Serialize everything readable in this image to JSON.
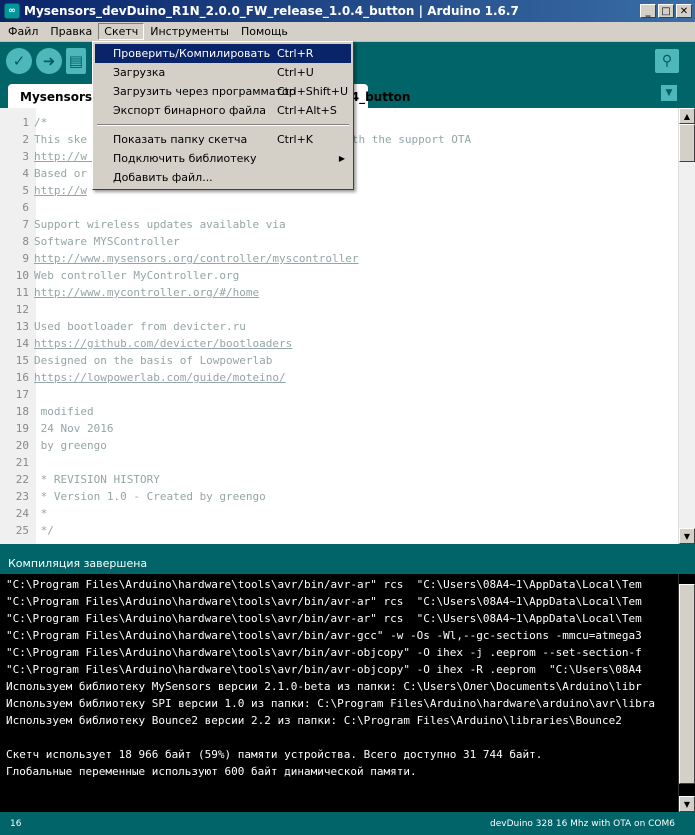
{
  "window": {
    "title": "Mysensors_devDuino_R1N_2.0.0_FW_release_1.0.4_button | Arduino 1.6.7",
    "app_icon": "arduino-logo-icon"
  },
  "menubar": {
    "items": [
      "Файл",
      "Правка",
      "Скетч",
      "Инструменты",
      "Помощь"
    ]
  },
  "tabs": {
    "active": "Mysensors_devDuino_R1N_2.0.0_FW_release_1.0.4_button"
  },
  "sketch_menu": {
    "items": [
      {
        "label": "Проверить/Компилировать",
        "accel": "Ctrl+R"
      },
      {
        "label": "Загрузка",
        "accel": "Ctrl+U"
      },
      {
        "label": "Загрузить через программатор",
        "accel": "Ctrl+Shift+U"
      },
      {
        "label": "Экспорт бинарного файла",
        "accel": "Ctrl+Alt+S"
      },
      {
        "label": "Показать папку скетча",
        "accel": "Ctrl+K"
      },
      {
        "label": "Подключить библиотеку",
        "accel": ""
      },
      {
        "label": "Добавить файл...",
        "accel": ""
      }
    ]
  },
  "editor": {
    "lines": [
      {
        "n": "1",
        "text": "/*"
      },
      {
        "n": "2",
        "text": "This ske                                   .0 with the support OTA"
      },
      {
        "n": "3",
        "text": "http://w                                   V1.0",
        "link": true
      },
      {
        "n": "4",
        "text": "Based or"
      },
      {
        "n": "5",
        "text": "http://w",
        "link": true
      },
      {
        "n": "6",
        "text": ""
      },
      {
        "n": "7",
        "text": "Support wireless updates available via"
      },
      {
        "n": "8",
        "text": "Software MYSController"
      },
      {
        "n": "9",
        "text": "http://www.mysensors.org/controller/myscontroller",
        "link": true
      },
      {
        "n": "10",
        "text": "Web controller MyController.org"
      },
      {
        "n": "11",
        "text": "http://www.mycontroller.org/#/home",
        "link": true
      },
      {
        "n": "12",
        "text": ""
      },
      {
        "n": "13",
        "text": "Used bootloader from devicter.ru"
      },
      {
        "n": "14",
        "text": "https://github.com/devicter/bootloaders",
        "link": true
      },
      {
        "n": "15",
        "text": "Designed on the basis of Lowpowerlab"
      },
      {
        "n": "16",
        "text": "https://lowpowerlab.com/guide/moteino/",
        "link": true
      },
      {
        "n": "17",
        "text": ""
      },
      {
        "n": "18",
        "text": " modified"
      },
      {
        "n": "19",
        "text": " 24 Nov 2016"
      },
      {
        "n": "20",
        "text": " by greengo"
      },
      {
        "n": "21",
        "text": ""
      },
      {
        "n": "22",
        "text": " * REVISION HISTORY"
      },
      {
        "n": "23",
        "text": " * Version 1.0 - Created by greengo"
      },
      {
        "n": "24",
        "text": " *"
      },
      {
        "n": "25",
        "text": " */"
      }
    ]
  },
  "status": {
    "message": "Компиляция завершена"
  },
  "console": {
    "lines": [
      "\"C:\\Program Files\\Arduino\\hardware\\tools\\avr/bin/avr-ar\" rcs  \"C:\\Users\\08A4~1\\AppData\\Local\\Tem",
      "\"C:\\Program Files\\Arduino\\hardware\\tools\\avr/bin/avr-ar\" rcs  \"C:\\Users\\08A4~1\\AppData\\Local\\Tem",
      "\"C:\\Program Files\\Arduino\\hardware\\tools\\avr/bin/avr-ar\" rcs  \"C:\\Users\\08A4~1\\AppData\\Local\\Tem",
      "\"C:\\Program Files\\Arduino\\hardware\\tools\\avr/bin/avr-gcc\" -w -Os -Wl,--gc-sections -mmcu=atmega3",
      "\"C:\\Program Files\\Arduino\\hardware\\tools\\avr/bin/avr-objcopy\" -O ihex -j .eeprom --set-section-f",
      "\"C:\\Program Files\\Arduino\\hardware\\tools\\avr/bin/avr-objcopy\" -O ihex -R .eeprom  \"C:\\Users\\08A4",
      "Используем библиотеку MySensors версии 2.1.0-beta из папки: C:\\Users\\Олег\\Documents\\Arduino\\libr",
      "Используем библиотеку SPI версии 1.0 из папки: C:\\Program Files\\Arduino\\hardware\\arduino\\avr\\libra",
      "Используем библиотеку Bounce2 версии 2.2 из папки: C:\\Program Files\\Arduino\\libraries\\Bounce2",
      "",
      "Скетч использует 18 966 байт (59%) памяти устройства. Всего доступно 31 744 байт.",
      "Глобальные переменные используют 600 байт динамической памяти."
    ]
  },
  "footer": {
    "line_number": "16",
    "board": "devDuino 328 16 Mhz with OTA on COM6"
  },
  "colors": {
    "teal_dark": "#006468",
    "teal_light": "#4db7bb",
    "menu_highlight": "#0a246a"
  }
}
